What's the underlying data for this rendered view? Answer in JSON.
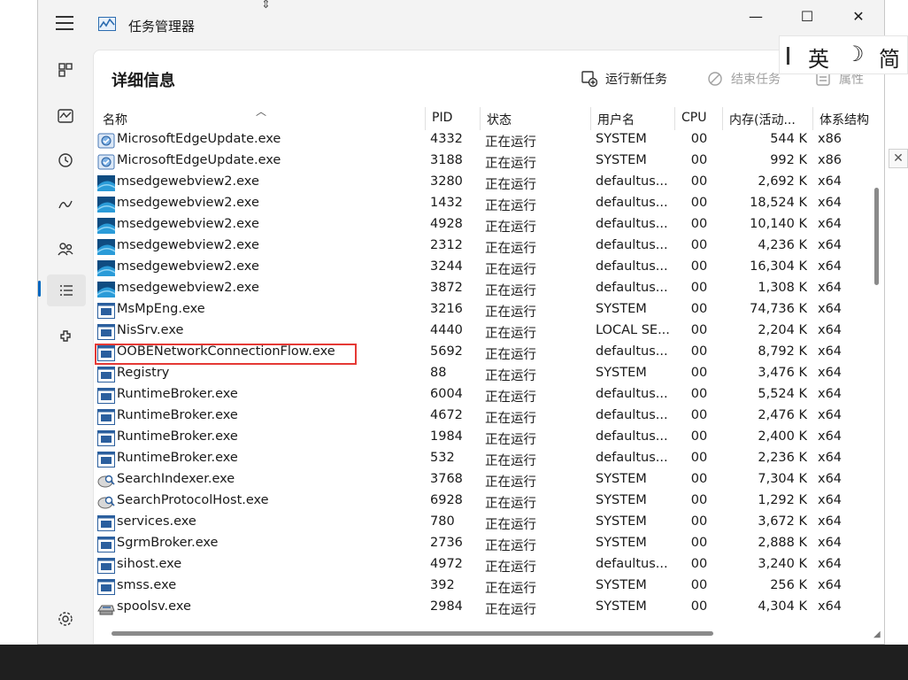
{
  "app": {
    "title": "任务管理器",
    "page_title": "详细信息"
  },
  "window_controls": {
    "minimize": "—",
    "maximize": "☐",
    "close": "✕"
  },
  "commands": {
    "run_new_task": "运行新任务",
    "end_task": "结束任务",
    "properties": "属性"
  },
  "columns": {
    "name": "名称",
    "pid": "PID",
    "status": "状态",
    "user": "用户名",
    "cpu": "CPU",
    "memory": "内存(活动...",
    "arch": "体系结构"
  },
  "ime": {
    "lang": "英",
    "moon": "☽",
    "mode": "简"
  },
  "processes": [
    {
      "name": "MicrosoftEdgeUpdate.exe",
      "pid": "4332",
      "status": "正在运行",
      "user": "SYSTEM",
      "cpu": "00",
      "mem": "544 K",
      "arch": "x86",
      "icon": "edge-update-icon"
    },
    {
      "name": "MicrosoftEdgeUpdate.exe",
      "pid": "3188",
      "status": "正在运行",
      "user": "SYSTEM",
      "cpu": "00",
      "mem": "992 K",
      "arch": "x86",
      "icon": "edge-update-icon"
    },
    {
      "name": "msedgewebview2.exe",
      "pid": "3280",
      "status": "正在运行",
      "user": "defaultus...",
      "cpu": "00",
      "mem": "2,692 K",
      "arch": "x64",
      "icon": "webview-icon"
    },
    {
      "name": "msedgewebview2.exe",
      "pid": "1432",
      "status": "正在运行",
      "user": "defaultus...",
      "cpu": "00",
      "mem": "18,524 K",
      "arch": "x64",
      "icon": "webview-icon"
    },
    {
      "name": "msedgewebview2.exe",
      "pid": "4928",
      "status": "正在运行",
      "user": "defaultus...",
      "cpu": "00",
      "mem": "10,140 K",
      "arch": "x64",
      "icon": "webview-icon"
    },
    {
      "name": "msedgewebview2.exe",
      "pid": "2312",
      "status": "正在运行",
      "user": "defaultus...",
      "cpu": "00",
      "mem": "4,236 K",
      "arch": "x64",
      "icon": "webview-icon"
    },
    {
      "name": "msedgewebview2.exe",
      "pid": "3244",
      "status": "正在运行",
      "user": "defaultus...",
      "cpu": "00",
      "mem": "16,304 K",
      "arch": "x64",
      "icon": "webview-icon"
    },
    {
      "name": "msedgewebview2.exe",
      "pid": "3872",
      "status": "正在运行",
      "user": "defaultus...",
      "cpu": "00",
      "mem": "1,308 K",
      "arch": "x64",
      "icon": "webview-icon"
    },
    {
      "name": "MsMpEng.exe",
      "pid": "3216",
      "status": "正在运行",
      "user": "SYSTEM",
      "cpu": "00",
      "mem": "74,736 K",
      "arch": "x64",
      "icon": "exe-icon"
    },
    {
      "name": "NisSrv.exe",
      "pid": "4440",
      "status": "正在运行",
      "user": "LOCAL SE...",
      "cpu": "00",
      "mem": "2,204 K",
      "arch": "x64",
      "icon": "exe-icon"
    },
    {
      "name": "OOBENetworkConnectionFlow.exe",
      "pid": "5692",
      "status": "正在运行",
      "user": "defaultus...",
      "cpu": "00",
      "mem": "8,792 K",
      "arch": "x64",
      "icon": "exe-icon",
      "highlighted": true
    },
    {
      "name": "Registry",
      "pid": "88",
      "status": "正在运行",
      "user": "SYSTEM",
      "cpu": "00",
      "mem": "3,476 K",
      "arch": "x64",
      "icon": "exe-icon"
    },
    {
      "name": "RuntimeBroker.exe",
      "pid": "6004",
      "status": "正在运行",
      "user": "defaultus...",
      "cpu": "00",
      "mem": "5,524 K",
      "arch": "x64",
      "icon": "exe-icon"
    },
    {
      "name": "RuntimeBroker.exe",
      "pid": "4672",
      "status": "正在运行",
      "user": "defaultus...",
      "cpu": "00",
      "mem": "2,476 K",
      "arch": "x64",
      "icon": "exe-icon"
    },
    {
      "name": "RuntimeBroker.exe",
      "pid": "1984",
      "status": "正在运行",
      "user": "defaultus...",
      "cpu": "00",
      "mem": "2,400 K",
      "arch": "x64",
      "icon": "exe-icon"
    },
    {
      "name": "RuntimeBroker.exe",
      "pid": "532",
      "status": "正在运行",
      "user": "defaultus...",
      "cpu": "00",
      "mem": "2,236 K",
      "arch": "x64",
      "icon": "exe-icon"
    },
    {
      "name": "SearchIndexer.exe",
      "pid": "3768",
      "status": "正在运行",
      "user": "SYSTEM",
      "cpu": "00",
      "mem": "7,304 K",
      "arch": "x64",
      "icon": "search-indexer-icon"
    },
    {
      "name": "SearchProtocolHost.exe",
      "pid": "6928",
      "status": "正在运行",
      "user": "SYSTEM",
      "cpu": "00",
      "mem": "1,292 K",
      "arch": "x64",
      "icon": "search-indexer-icon"
    },
    {
      "name": "services.exe",
      "pid": "780",
      "status": "正在运行",
      "user": "SYSTEM",
      "cpu": "00",
      "mem": "3,672 K",
      "arch": "x64",
      "icon": "exe-icon"
    },
    {
      "name": "SgrmBroker.exe",
      "pid": "2736",
      "status": "正在运行",
      "user": "SYSTEM",
      "cpu": "00",
      "mem": "2,888 K",
      "arch": "x64",
      "icon": "exe-icon"
    },
    {
      "name": "sihost.exe",
      "pid": "4972",
      "status": "正在运行",
      "user": "defaultus...",
      "cpu": "00",
      "mem": "3,240 K",
      "arch": "x64",
      "icon": "exe-icon"
    },
    {
      "name": "smss.exe",
      "pid": "392",
      "status": "正在运行",
      "user": "SYSTEM",
      "cpu": "00",
      "mem": "256 K",
      "arch": "x64",
      "icon": "exe-icon"
    },
    {
      "name": "spoolsv.exe",
      "pid": "2984",
      "status": "正在运行",
      "user": "SYSTEM",
      "cpu": "00",
      "mem": "4,304 K",
      "arch": "x64",
      "icon": "printer-icon"
    }
  ]
}
